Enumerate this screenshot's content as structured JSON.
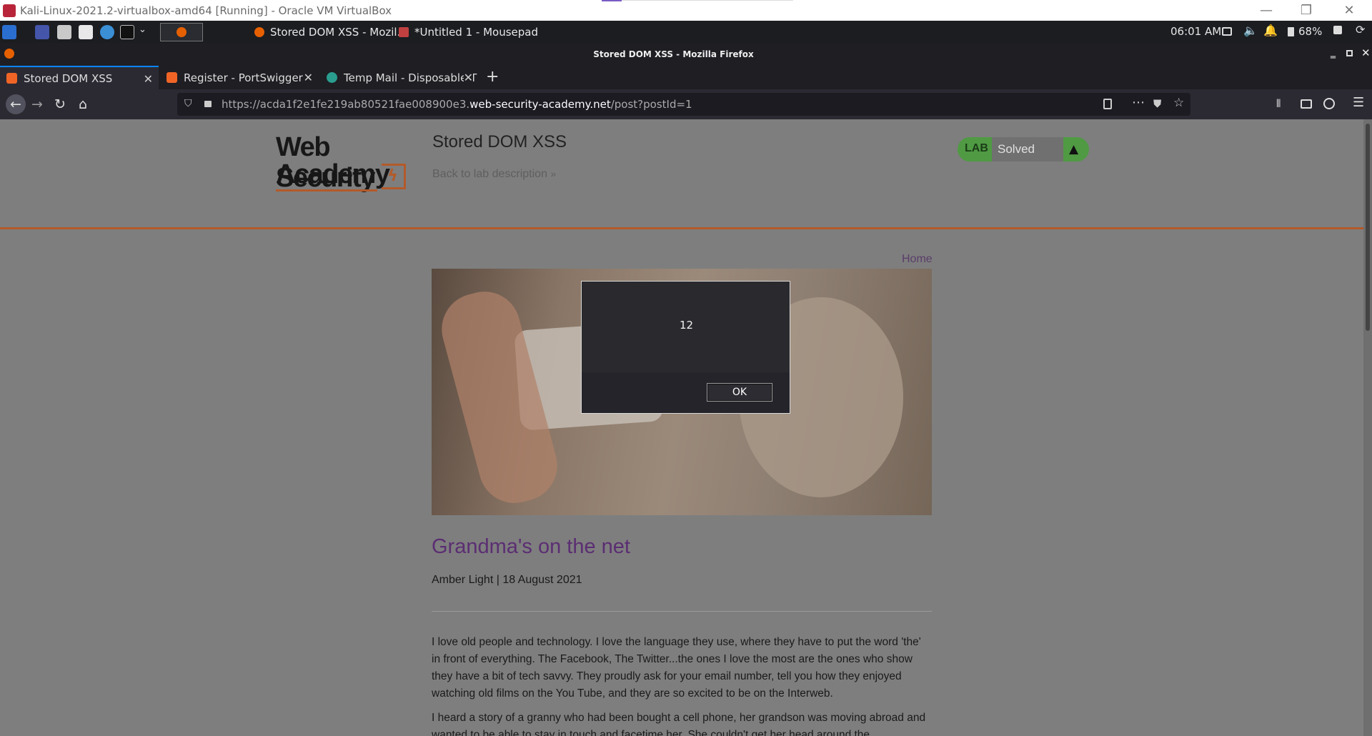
{
  "vbox": {
    "title": "Kali-Linux-2021.2-virtualbox-amd64 [Running] - Oracle VM VirtualBox",
    "minimize": "—",
    "restore": "❐",
    "close": "✕"
  },
  "kali": {
    "tasks": [
      {
        "label": "Stored DOM XSS - Mozil..."
      },
      {
        "label": "*Untitled 1 - Mousepad"
      }
    ],
    "clock": "06:01 AM",
    "battery": "68%"
  },
  "firefox": {
    "window_title": "Stored DOM XSS - Mozilla Firefox",
    "tabs": [
      {
        "label": "Stored DOM XSS"
      },
      {
        "label": "Register - PortSwigger"
      },
      {
        "label": "Temp Mail - Disposable T"
      }
    ],
    "url": {
      "prefix": "https://acda1f2e1fe219ab80521fae008900e3.",
      "host": "web-security-academy.net",
      "path": "/post?postId=1"
    }
  },
  "page": {
    "logo": {
      "line1": "Web Security",
      "line2": "Academy"
    },
    "lab_title": "Stored DOM XSS",
    "back_link": "Back to lab description",
    "badge": {
      "lab": "LAB",
      "status": "Solved"
    },
    "home": "Home",
    "post_title": "Grandma's on the net",
    "meta": "Amber Light | 18 August 2021",
    "paragraphs": [
      "I love old people and technology. I love the language they use, where they have to put the word 'the' in front of everything. The Facebook, The Twitter...the ones I love the most are the ones who show they have a bit of tech savvy. They proudly ask for your email number, tell you how they enjoyed watching old films on the You Tube, and they are so excited to be on the Interweb.",
      "I heard a story of a granny who had been bought a cell phone, her grandson was moving abroad and wanted to be able to stay in touch and facetime her. She couldn't get her head around the"
    ]
  },
  "dialog": {
    "message": "12",
    "ok": "OK"
  },
  "colors": {
    "accent": "#8a5aa0",
    "brand_orange": "#b35a2a",
    "lab_green": "#5aa04a"
  }
}
